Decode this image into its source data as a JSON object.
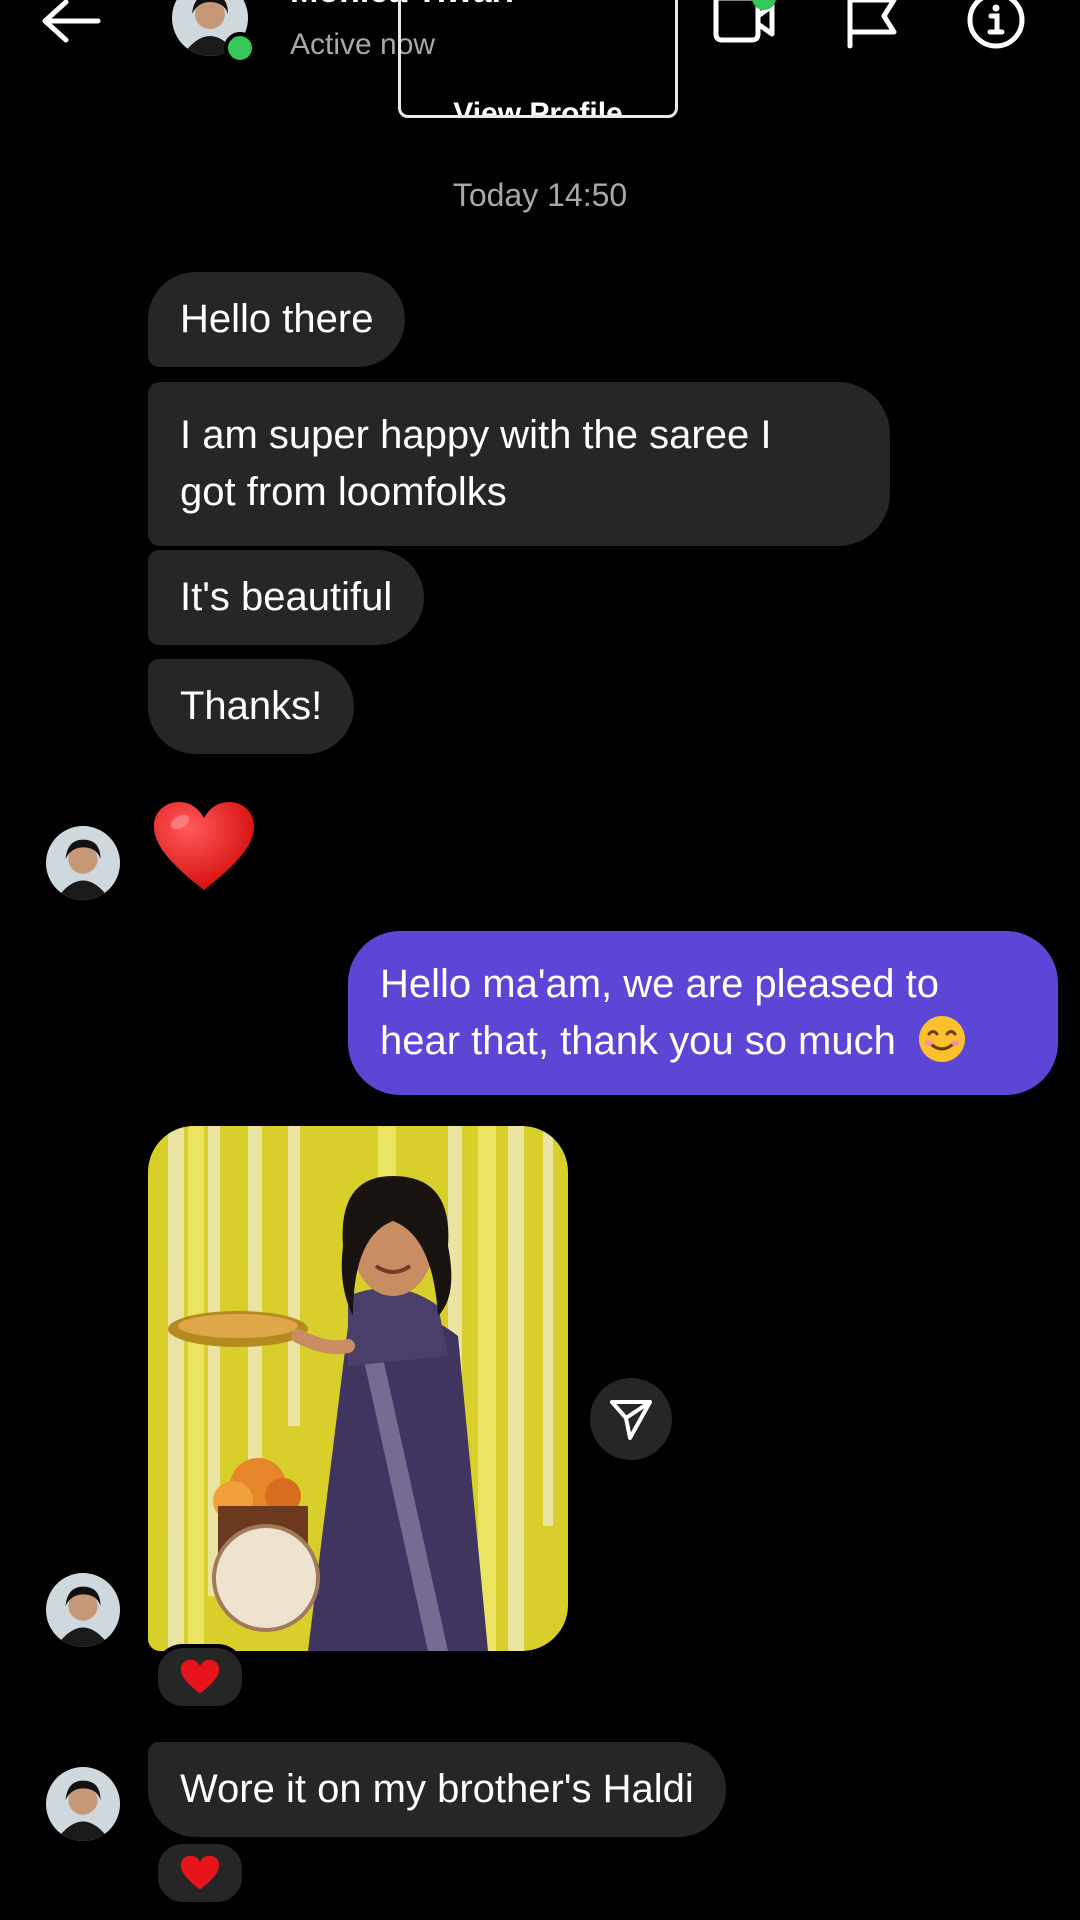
{
  "header": {
    "back_icon": "arrow-left-icon",
    "contact_name": "Monica Tiwari",
    "status": "Active now",
    "icons": [
      "video-call-icon",
      "flag-icon",
      "info-icon"
    ],
    "status_color": "#35c759"
  },
  "profile": {
    "view_profile_label": "View Profile"
  },
  "thread": {
    "timestamp": "Today 14:50",
    "incoming": [
      {
        "text": "Hello there"
      },
      {
        "text_lines": [
          "I am super happy with the saree I",
          "got from loomfolks"
        ]
      },
      {
        "text": "It's beautiful"
      },
      {
        "text": "Thanks!"
      }
    ],
    "heart_message": "heart-emoji",
    "outgoing": {
      "text_lines": [
        "Hello ma'am, we are pleased to",
        "hear that, thank you so much"
      ],
      "emoji": "smiling-face-emoji",
      "color": "#5b46d6"
    },
    "photo": {
      "subject": "woman in purple saree holding a plate",
      "reaction": "heart"
    },
    "last_message": {
      "text": "Wore it on my brother's Haldi",
      "reaction": "heart"
    }
  },
  "colors": {
    "background": "#000000",
    "bubble_incoming": "#262626",
    "text_muted": "#a8a8a8"
  }
}
